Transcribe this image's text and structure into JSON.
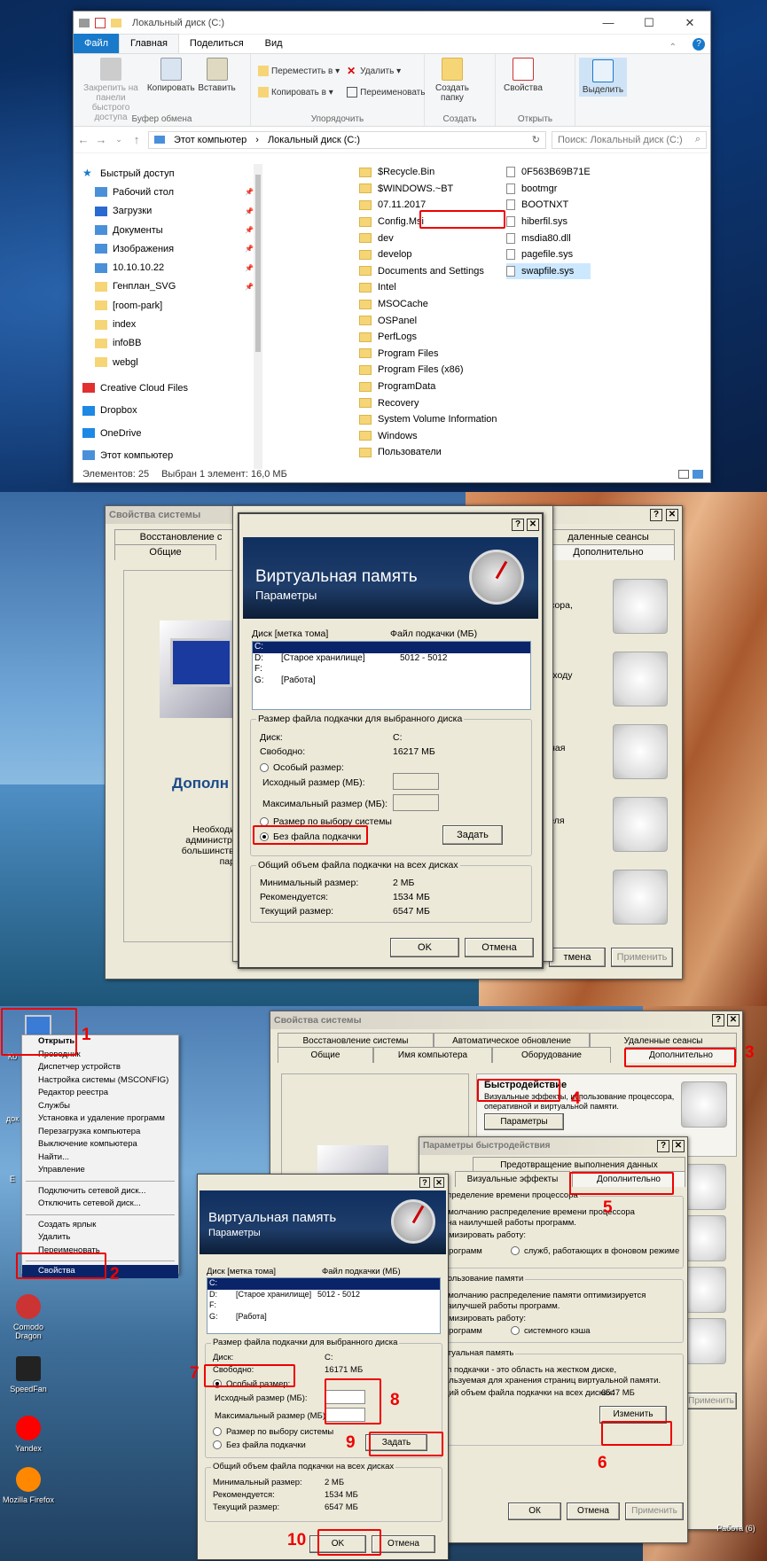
{
  "explorer": {
    "title": "Локальный диск (C:)",
    "window_controls": [
      "—",
      "☐",
      "✕"
    ],
    "tabs": [
      "Файл",
      "Главная",
      "Поделиться",
      "Вид"
    ],
    "ribbon": {
      "pin": "Закрепить на панели быстрого доступа",
      "copy": "Копировать",
      "paste": "Вставить",
      "group_clipboard": "Буфер обмена",
      "move_to": "Переместить в ▾",
      "copy_to": "Копировать в ▾",
      "delete": "Удалить ▾",
      "rename": "Переименовать",
      "group_organize": "Упорядочить",
      "new_folder": "Создать папку",
      "group_new": "Создать",
      "properties": "Свойства",
      "group_open": "Открыть",
      "select": "Выделить"
    },
    "address": {
      "nav_back": "←",
      "nav_fwd": "→",
      "nav_up": "↑",
      "path": [
        "Этот компьютер",
        "Локальный диск (C:)"
      ],
      "refresh": "↻",
      "search_placeholder": "Поиск: Локальный диск (C:)"
    },
    "tree": [
      {
        "label": "Быстрый доступ",
        "pin": false
      },
      {
        "label": "Рабочий стол",
        "pin": true
      },
      {
        "label": "Загрузки",
        "pin": true
      },
      {
        "label": "Документы",
        "pin": true
      },
      {
        "label": "Изображения",
        "pin": true
      },
      {
        "label": "10.10.10.22",
        "pin": true
      },
      {
        "label": "Генплан_SVG",
        "pin": true
      },
      {
        "label": "[room-park]",
        "pin": false
      },
      {
        "label": "index",
        "pin": false
      },
      {
        "label": "infoBB",
        "pin": false
      },
      {
        "label": "webgl",
        "pin": false
      },
      {
        "label": "Creative Cloud Files",
        "pin": false
      },
      {
        "label": "Dropbox",
        "pin": false
      },
      {
        "label": "OneDrive",
        "pin": false
      },
      {
        "label": "Этот компьютер",
        "pin": false
      }
    ],
    "folders": [
      "$Recycle.Bin",
      "$WINDOWS.~BT",
      "07.11.2017",
      "Config.Msi",
      "dev",
      "develop",
      "Documents and Settings",
      "Intel",
      "MSOCache",
      "OSPanel",
      "PerfLogs",
      "Program Files",
      "Program Files (x86)",
      "ProgramData",
      "Recovery",
      "System Volume Information",
      "Windows",
      "Пользователи"
    ],
    "files": [
      "0F563B69B71E",
      "bootmgr",
      "BOOTNXT",
      "hiberfil.sys",
      "msdia80.dll",
      "pagefile.sys",
      "swapfile.sys"
    ],
    "status": {
      "count": "Элементов: 25",
      "selected": "Выбран 1 элемент: 16,0 МБ"
    }
  },
  "dlg2": {
    "sysprops_title": "Свойства системы",
    "tabs_top": [
      "Восстановление с",
      "даленные сеансы"
    ],
    "tabs_bottom": [
      "Общие",
      "Дополнительно"
    ],
    "left_heading": "Дополн",
    "left_text": [
      "Необходимо",
      "администрато",
      "большинства п",
      "парам"
    ],
    "right_labels": [
      "ессора,",
      "и входу",
      "очная",
      "ателя",
      "ия"
    ],
    "vm_title": "Виртуальная память",
    "vm_subtitle": "Параметры",
    "col_disk": "Диск [метка тома]",
    "col_file": "Файл подкачки (МБ)",
    "drives": [
      {
        "d": "C:",
        "label": "",
        "size": ""
      },
      {
        "d": "D:",
        "label": "[Старое хранилище]",
        "size": "5012 - 5012"
      },
      {
        "d": "F:",
        "label": "",
        "size": ""
      },
      {
        "d": "G:",
        "label": "[Работа]",
        "size": ""
      }
    ],
    "group_size": "Размер файла подкачки для выбранного диска",
    "disk_label": "Диск:",
    "disk_val": "C:",
    "free_label": "Свободно:",
    "free_val": "16217 МБ",
    "opt_custom": "Особый размер:",
    "initial": "Исходный размер (МБ):",
    "maximum": "Максимальный размер (МБ):",
    "opt_system": "Размер по выбору системы",
    "opt_none": "Без файла подкачки",
    "set_btn": "Задать",
    "group_total": "Общий объем файла подкачки на всех дисках",
    "min_label": "Минимальный размер:",
    "min_val": "2 МБ",
    "rec_label": "Рекомендуется:",
    "rec_val": "1534 МБ",
    "cur_label": "Текущий размер:",
    "cur_val": "6547 МБ",
    "ok": "OK",
    "cancel": "Отмена",
    "bg_cancel": "тмена",
    "bg_apply": "Применить",
    "help": "?",
    "close": "✕"
  },
  "p3": {
    "context_menu": [
      "Открыть",
      "Проводник",
      "Диспетчер устройств",
      "Настройка системы (MSCONFIG)",
      "Редактор реестра",
      "Службы",
      "Установка и удаление программ",
      "Перезагрузка компьютера",
      "Выключение компьютера",
      "Найти...",
      "Управление",
      "---",
      "Подключить сетевой диск...",
      "Отключить сетевой диск...",
      "---",
      "Создать ярлык",
      "Удалить",
      "Переименовать",
      "---",
      "Свойства"
    ],
    "desktop_icons": [
      "Comodo Dragon",
      "SpeedFan",
      "Yandex",
      "Mozilla Firefox"
    ],
    "desktop_partial": [
      "Ко",
      "док",
      "Е"
    ],
    "recycle": "Работа (6)",
    "sp_title": "Свойства системы",
    "sp_tabs_top": [
      "Восстановление системы",
      "Автоматическое обновление",
      "Удаленные сеансы"
    ],
    "sp_tabs_bottom": [
      "Общие",
      "Имя компьютера",
      "Оборудование",
      "Дополнительно"
    ],
    "perf_heading": "Быстродействие",
    "perf_text": [
      "Визуальные эффекты, использование процессора,",
      "оперативной и виртуальной памяти."
    ],
    "params_btn": "Параметры",
    "sp_ok": "ОК",
    "sp_cancel": "Отмена",
    "sp_apply": "Применить",
    "pp_title": "Параметры быстродействия",
    "pp_tabs_top": [
      "Предотвращение выполнения данных"
    ],
    "pp_tabs_bottom": [
      "Визуальные эффекты",
      "Дополнительно"
    ],
    "pp_cpu_head": "Распределение времени процессора",
    "pp_cpu_text": [
      "По умолчанию распределение времени процессора",
      "ено на наилучшей работы программ."
    ],
    "pp_optimize": "оптимизировать работу:",
    "pp_prog": "программ",
    "pp_services": "служб, работающих в фоновом режиме",
    "pp_mem_head": "Использование памяти",
    "pp_mem_text": [
      "По умолчанию распределение памяти оптимизируется",
      "на наилучшей работы программ."
    ],
    "pp_cache": "системного кэша",
    "pp_vm_head": "Виртуальная память",
    "pp_vm_text": [
      "Файл подкачки - это область на жестком диске,",
      "используемая для хранения страниц виртуальной памяти."
    ],
    "pp_vm_total": "Общий объем файла подкачки на всех дисках:",
    "pp_vm_val": "6547 МБ",
    "change_btn": "Изменить",
    "vm_title": "Виртуальная память",
    "vm_subtitle": "Параметры",
    "col_disk": "Диск [метка тома]",
    "col_file": "Файл подкачки (МБ)",
    "drives": [
      {
        "d": "C:",
        "label": "",
        "size": ""
      },
      {
        "d": "D:",
        "label": "[Старое хранилище]",
        "size": "5012 - 5012"
      },
      {
        "d": "F:",
        "label": "",
        "size": ""
      },
      {
        "d": "G:",
        "label": "[Работа]",
        "size": ""
      }
    ],
    "group_size": "Размер файла подкачки для выбранного диска",
    "disk_label": "Диск:",
    "disk_val": "C:",
    "free_label": "Свободно:",
    "free_val": "16171 МБ",
    "opt_custom": "Особый размер:",
    "initial": "Исходный размер (МБ):",
    "maximum": "Максимальный размер (МБ):",
    "opt_system": "Размер по выбору системы",
    "opt_none": "Без файла подкачки",
    "set_btn": "Задать",
    "group_total": "Общий объем файла подкачки на всех дисках",
    "min_label": "Минимальный размер:",
    "min_val": "2 МБ",
    "rec_label": "Рекомендуется:",
    "rec_val": "1534 МБ",
    "cur_label": "Текущий размер:",
    "cur_val": "6547 МБ",
    "ok": "OK",
    "cancel": "Отмена",
    "help": "?",
    "close": "✕",
    "steps": [
      "1",
      "2",
      "3",
      "4",
      "5",
      "6",
      "7",
      "8",
      "9",
      "10"
    ]
  },
  "colors": {
    "accent_red": "#e00000",
    "xp_face": "#ece9d8",
    "win10_blue": "#1979ca",
    "selection": "#0a246a"
  }
}
